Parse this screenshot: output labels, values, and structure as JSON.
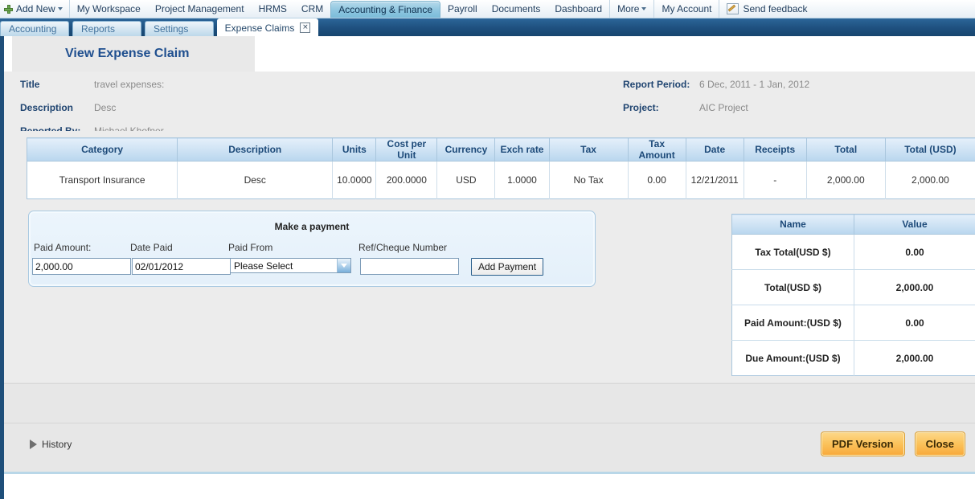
{
  "topnav": {
    "add_new": "Add New",
    "items": [
      {
        "label": "My Workspace",
        "active": false
      },
      {
        "label": "Project Management",
        "active": false
      },
      {
        "label": "HRMS",
        "active": false
      },
      {
        "label": "CRM",
        "active": false
      },
      {
        "label": "Accounting & Finance",
        "active": true
      },
      {
        "label": "Payroll",
        "active": false
      },
      {
        "label": "Documents",
        "active": false
      },
      {
        "label": "Dashboard",
        "active": false
      },
      {
        "label": "More",
        "active": false
      },
      {
        "label": "My Account",
        "active": false
      }
    ],
    "feedback": "Send feedback",
    "feedback_icon": "pencil-note-icon",
    "add_new_icon": "green-plus-icon",
    "caret_icon": "chevron-down-icon"
  },
  "subnav": {
    "tabs": [
      {
        "label": "Accounting",
        "active": false,
        "closable": false
      },
      {
        "label": "Reports",
        "active": false,
        "closable": false
      },
      {
        "label": "Settings",
        "active": false,
        "closable": false
      },
      {
        "label": "Expense Claims",
        "active": true,
        "closable": true
      }
    ],
    "close_glyph": "×",
    "close_icon": "close-icon"
  },
  "page": {
    "title": "View Expense Claim",
    "meta_left": [
      {
        "label": "Title",
        "value": "travel expenses:"
      },
      {
        "label": "Description",
        "value": "Desc"
      },
      {
        "label": "Reported By:",
        "value": "Michael Khofner"
      }
    ],
    "meta_right": [
      {
        "label": "Report Period:",
        "value": "6 Dec, 2011 - 1 Jan, 2012"
      },
      {
        "label": "Project:",
        "value": "AIC Project"
      }
    ]
  },
  "items_table": {
    "columns": [
      "Category",
      "Description",
      "Units",
      "Cost per Unit",
      "Currency",
      "Exch rate",
      "Tax",
      "Tax Amount",
      "Date",
      "Receipts",
      "Total",
      "Total (USD)"
    ],
    "rows": [
      [
        "Transport Insurance",
        "Desc",
        "10.0000",
        "200.0000",
        "USD",
        "1.0000",
        "No Tax",
        "0.00",
        "12/21/2011",
        "-",
        "2,000.00",
        "2,000.00"
      ]
    ]
  },
  "payment": {
    "title": "Make a payment",
    "labels": {
      "paid_amount": "Paid Amount:",
      "date_paid": "Date Paid",
      "paid_from": "Paid From",
      "ref_cheque": "Ref/Cheque Number"
    },
    "values": {
      "paid_amount": "2,000.00",
      "date_paid": "02/01/2012",
      "paid_from": "Please Select",
      "ref_cheque": ""
    },
    "placeholders": {
      "paid_amount": "",
      "date_paid": "",
      "ref_cheque": ""
    },
    "add_payment_label": "Add Payment",
    "dropdown_icon": "chevron-down-icon"
  },
  "summary_table": {
    "columns": [
      "Name",
      "Value"
    ],
    "rows": [
      [
        "Tax Total(USD $)",
        "0.00"
      ],
      [
        "Total(USD $)",
        "2,000.00"
      ],
      [
        "Paid Amount:(USD $)",
        "0.00"
      ],
      [
        "Due Amount:(USD $)",
        "2,000.00"
      ]
    ]
  },
  "footer": {
    "history": "History",
    "history_icon": "triangle-right-icon",
    "pdf_version": "PDF Version",
    "close": "Close"
  },
  "colors": {
    "accent_blue": "#1f4f7a",
    "header_blue": "#1d4a79",
    "button_orange": "#f8a93b",
    "panel_grey": "#ececec",
    "nav_dark": "#1f5180"
  }
}
